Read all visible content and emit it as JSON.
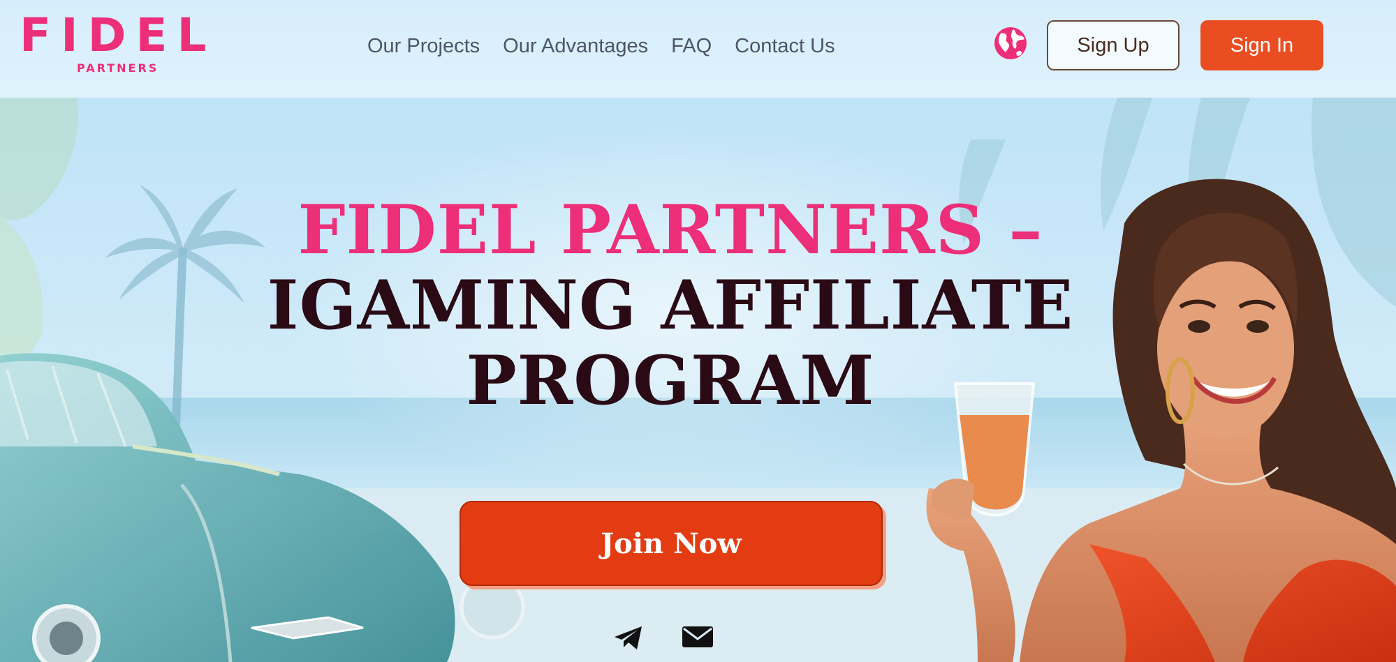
{
  "brand": {
    "name": "FIDEL",
    "sub": "PARTNERS",
    "color": "#ec2f78"
  },
  "nav": {
    "items": [
      "Our Projects",
      "Our Advantages",
      "FAQ",
      "Contact Us"
    ]
  },
  "header": {
    "globe_icon": "globe-icon",
    "signup_label": "Sign Up",
    "signin_label": "Sign In",
    "accent": "#ea4d22"
  },
  "hero": {
    "title_line1": "Fidel Partners –",
    "title_line2": "iGaming Affiliate",
    "title_line3": "Program",
    "cta_label": "Join Now",
    "social_icons": [
      "telegram-icon",
      "mail-icon"
    ]
  }
}
